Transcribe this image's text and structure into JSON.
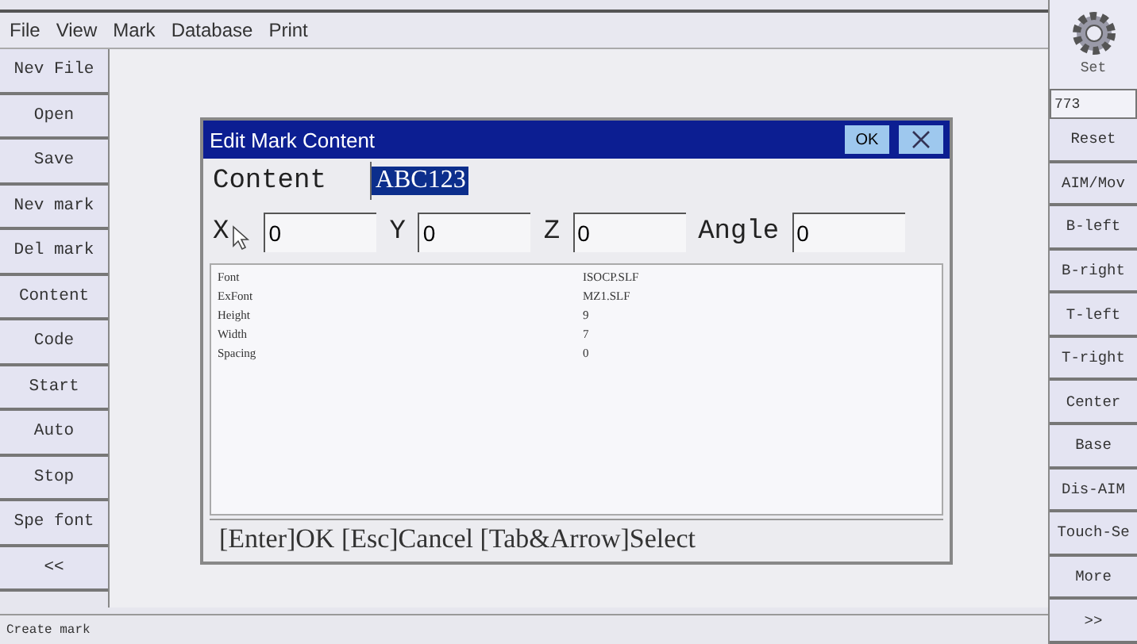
{
  "menu": [
    "File",
    "View",
    "Mark",
    "Database",
    "Print"
  ],
  "left_buttons": [
    "Nev File",
    "Open",
    "Save",
    "Nev mark",
    "Del mark",
    "Content",
    "Code",
    "Start",
    "Auto",
    "Stop",
    "Spe font",
    "<<"
  ],
  "right_panel": {
    "set_label": "Set",
    "counter": "773",
    "buttons": [
      "Reset",
      "AIM/Mov",
      "B-left",
      "B-right",
      "T-left",
      "T-right",
      "Center",
      "Base",
      "Dis-AIM",
      "Touch-Se",
      "More",
      ">>"
    ]
  },
  "dialog": {
    "title": "Edit Mark Content",
    "ok_button": "OK",
    "content_label": "Content",
    "content_value": "ABC123",
    "coords": [
      {
        "label": "X",
        "value": "0"
      },
      {
        "label": "Y",
        "value": "0"
      },
      {
        "label": "Z",
        "value": "0"
      },
      {
        "label": "Angle",
        "value": "0"
      }
    ],
    "properties": [
      {
        "name": "Font",
        "value": "ISOCP.SLF"
      },
      {
        "name": "ExFont",
        "value": "MZ1.SLF"
      },
      {
        "name": "Height",
        "value": "9"
      },
      {
        "name": "Width",
        "value": "7"
      },
      {
        "name": "Spacing",
        "value": "0"
      }
    ],
    "hint": "[Enter]OK [Esc]Cancel [Tab&Arrow]Select"
  },
  "status_bar": "Create mark"
}
